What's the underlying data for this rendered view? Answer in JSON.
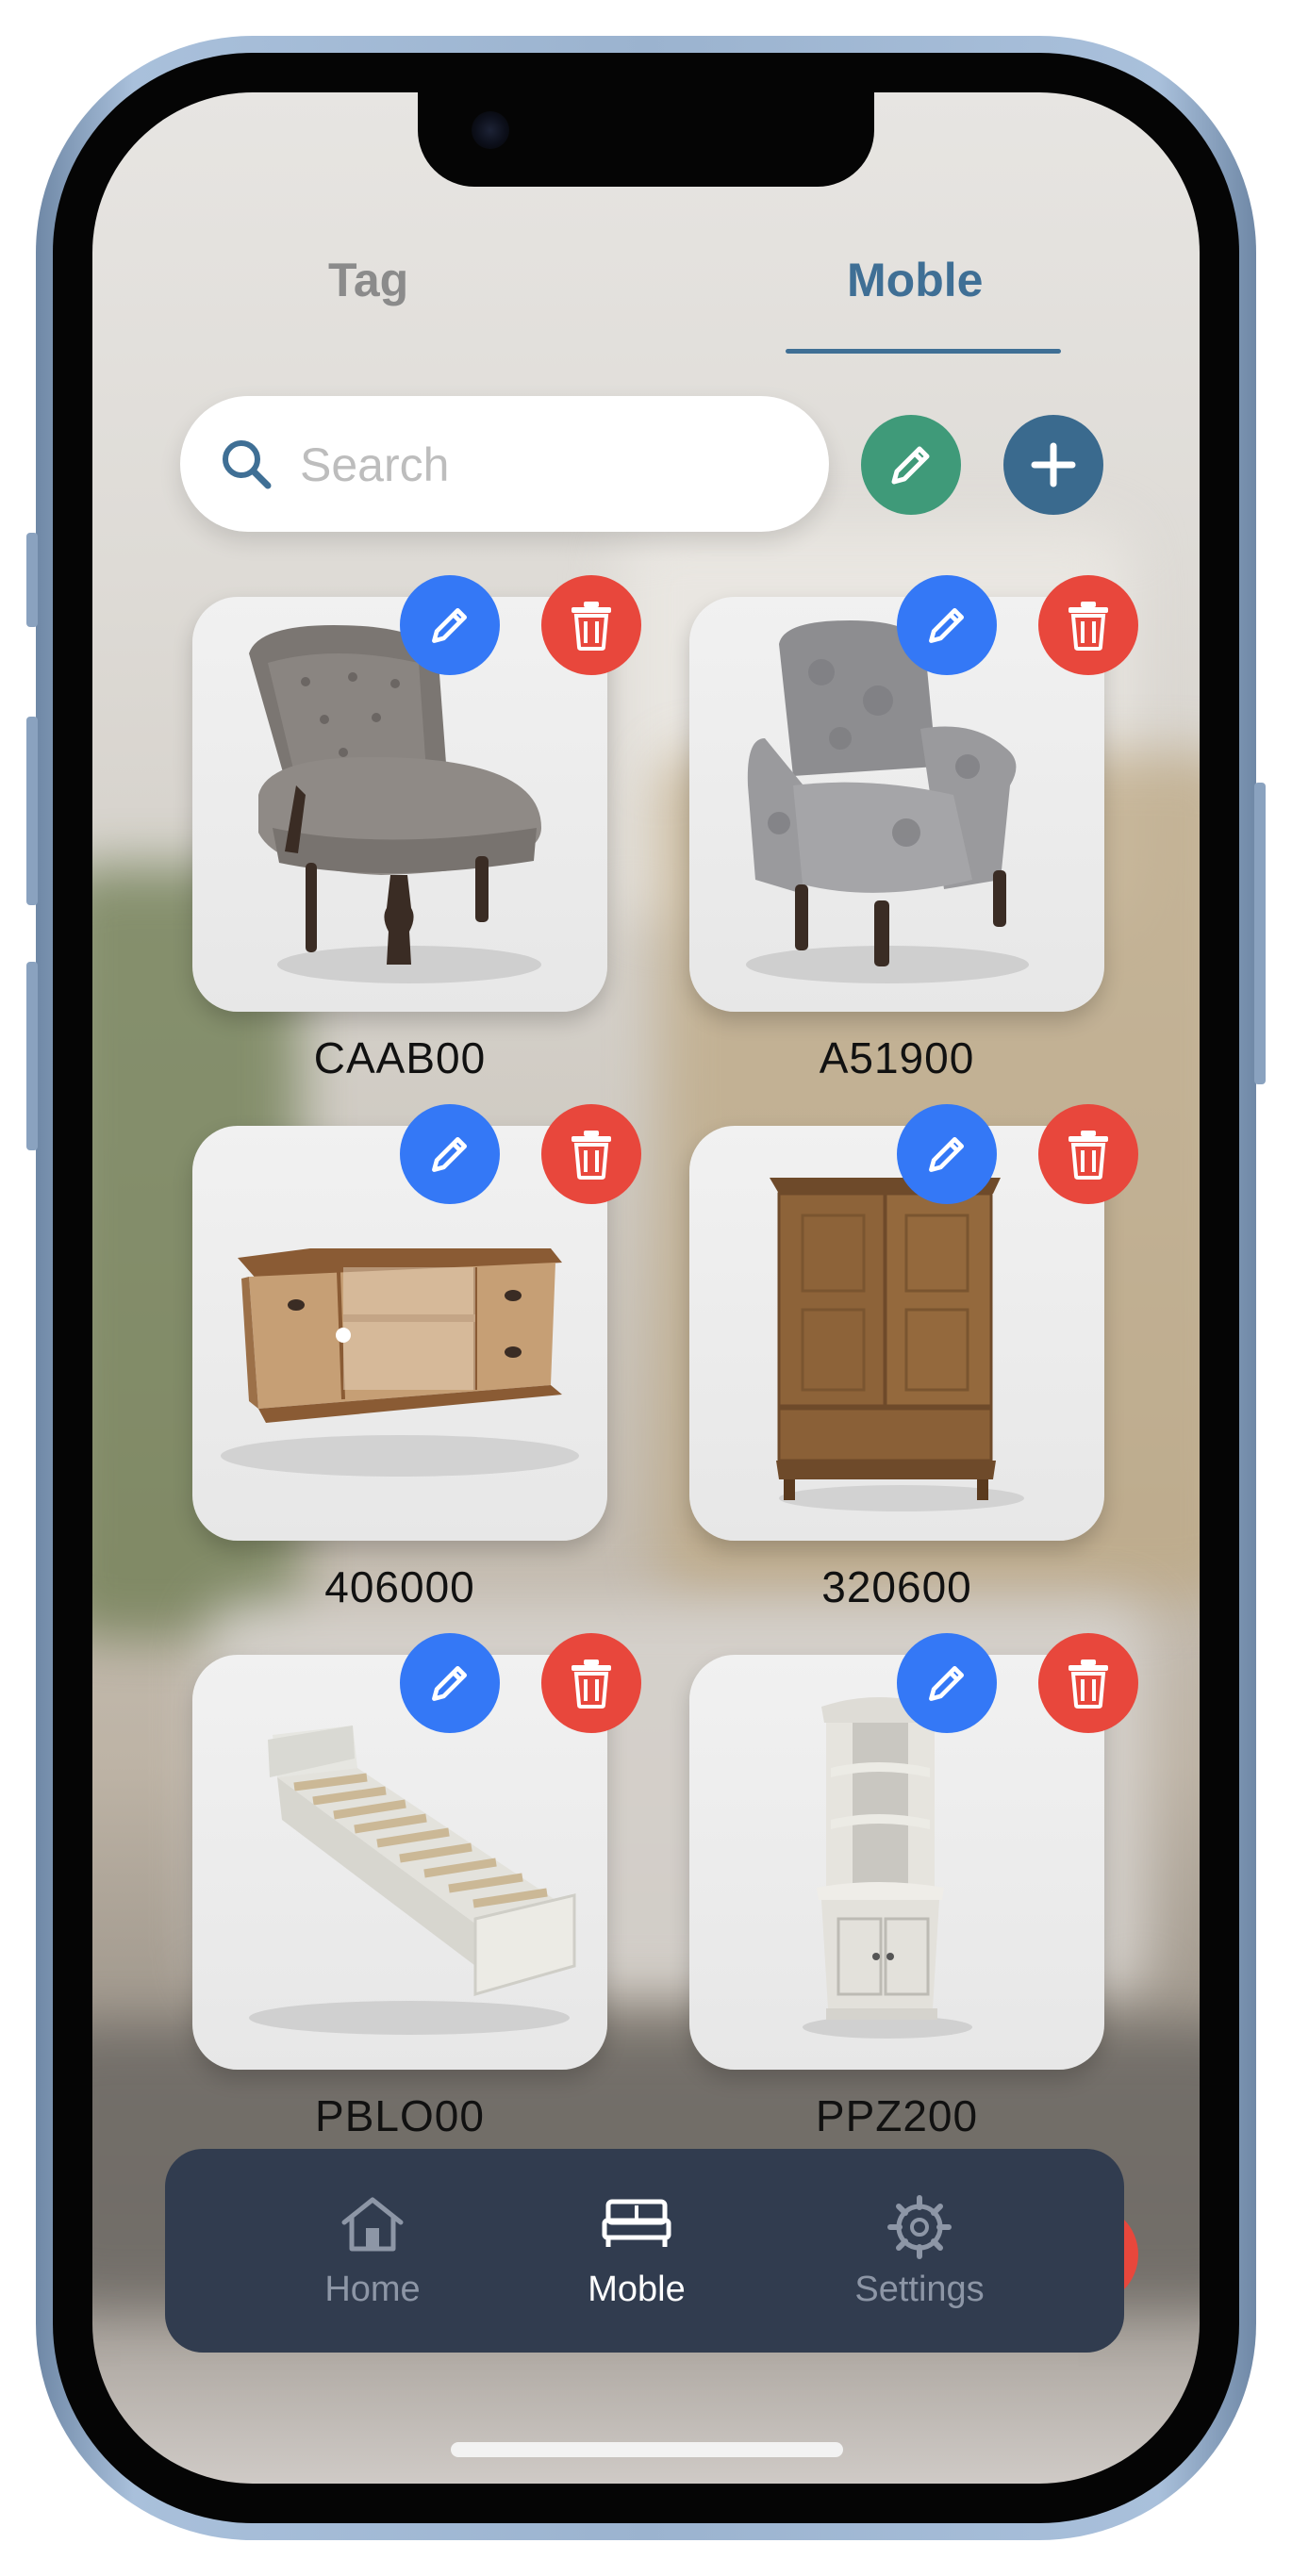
{
  "tabs": [
    {
      "label": "Tag",
      "active": false
    },
    {
      "label": "Moble",
      "active": true
    }
  ],
  "search": {
    "placeholder": "Search",
    "value": ""
  },
  "toolbar": {
    "edit_icon": "pencil-icon",
    "add_icon": "plus-icon"
  },
  "items": [
    {
      "code": "CAAB00",
      "kind": "tufted armless chair"
    },
    {
      "code": "A51900",
      "kind": "upholstered armchair"
    },
    {
      "code": "406000",
      "kind": "wooden TV cabinet"
    },
    {
      "code": "320600",
      "kind": "wooden wardrobe"
    },
    {
      "code": "PBLO00",
      "kind": "white single bed"
    },
    {
      "code": "PPZ200",
      "kind": "white corner shelf"
    }
  ],
  "nav": [
    {
      "label": "Home",
      "icon": "house-icon",
      "active": false
    },
    {
      "label": "Moble",
      "icon": "bed-icon",
      "active": true
    },
    {
      "label": "Settings",
      "icon": "gear-icon",
      "active": false
    }
  ],
  "colors": {
    "accent": "#3f6f95",
    "edit": "#3478f6",
    "delete": "#e8473c",
    "edit_all": "#3f9a79",
    "add": "#3a6a8e",
    "nav_bg": "#313c4f"
  }
}
